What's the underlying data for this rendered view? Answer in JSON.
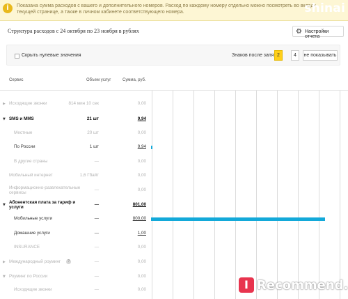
{
  "notice": {
    "icon": "info-icon",
    "line1": "Показана сумма расходов с вашего и дополнительного номеров. Расход по каждому номеру отдельно можно посмотреть во вкладке \"Детализ",
    "line2": "текущей странице, а также в личном кабинете соответствующего номера.",
    "watermark": "shinai"
  },
  "header": {
    "title": "Структура расходов с 24 октября по 23 ноября в рублях",
    "settings_label": "Настройки отчета",
    "settings_icon": "gear-icon"
  },
  "controls": {
    "hide_zero_label": "Скрыть нулевые значения",
    "hide_zero_checked": false,
    "decimals_label": "Знаков после запятой",
    "decimal_options": [
      "2",
      "4",
      "не показывать"
    ],
    "decimal_selected": "2"
  },
  "columns": {
    "service": "Сервис",
    "volume": "Объем услуг",
    "sum": "Сумма, руб."
  },
  "rows": [
    {
      "name": "Исходящие звонки",
      "volume": "814 мин 10 сек",
      "sum": "0,00",
      "style": "muted",
      "expander": "right"
    },
    {
      "name": "SMS и MMS",
      "volume": "21 шт",
      "sum": "9,94",
      "style": "bold",
      "expander": "down"
    },
    {
      "name": "Местные",
      "volume": "20 шт",
      "sum": "0,00",
      "style": "muted"
    },
    {
      "name": "По России",
      "volume": "1 шт",
      "sum": "9,94",
      "style": "normal",
      "bar_fraction": 0.007
    },
    {
      "name": "В другие страны",
      "volume": "—",
      "sum": "0,00",
      "style": "muted"
    },
    {
      "name": "Мобильный интернет",
      "volume": "1,6 Гбайт",
      "sum": "0,00",
      "style": "muted"
    },
    {
      "name": "Информационно-развлекательные сервисы",
      "volume": "—",
      "sum": "0,00",
      "style": "muted"
    },
    {
      "name": "Абонентская плата за тариф и услуги",
      "volume": "—",
      "sum": "801,00",
      "style": "bold",
      "expander": "down"
    },
    {
      "name": "Мобильные услуги",
      "volume": "—",
      "sum": "800,00",
      "style": "normal",
      "bar_fraction": 0.88
    },
    {
      "name": "Домашние услуги",
      "volume": "—",
      "sum": "1,00",
      "style": "normal"
    },
    {
      "name": "INSURANCE",
      "volume": "—",
      "sum": "0,00",
      "style": "muted"
    },
    {
      "name": "Международный роуминг",
      "volume": "—",
      "sum": "0,00",
      "style": "muted",
      "expander": "right",
      "help": "?"
    },
    {
      "name": "Роуминг по России",
      "volume": "—",
      "sum": "0,00",
      "style": "muted",
      "expander": "down"
    },
    {
      "name": "Исходящие звонки",
      "volume": "—",
      "sum": "0,00",
      "style": "muted"
    }
  ],
  "colors": {
    "accent": "#ffcf1a",
    "bar": "#13a9d9",
    "notice_bg": "#fdf6d4"
  },
  "watermark": {
    "badge": "I",
    "text": "Recommend.ru"
  }
}
